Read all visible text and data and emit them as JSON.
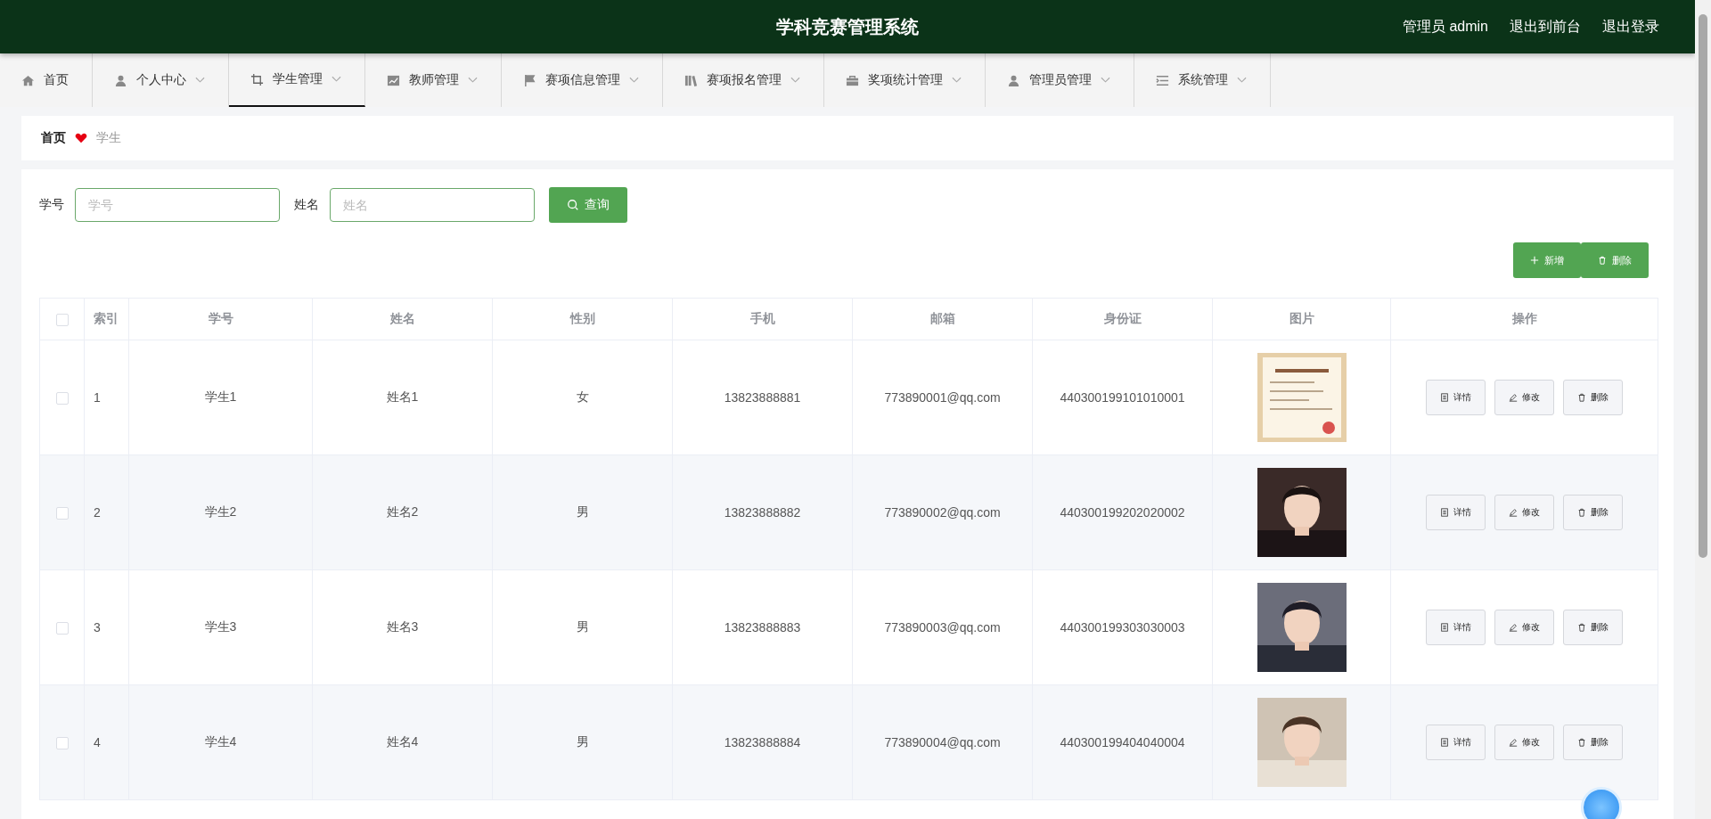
{
  "header": {
    "title": "学科竞赛管理系统",
    "user": "管理员 admin",
    "links": [
      "退出到前台",
      "退出登录"
    ]
  },
  "nav": [
    {
      "label": "首页",
      "dropdown": false,
      "selected": false
    },
    {
      "label": "个人中心",
      "dropdown": true,
      "selected": false
    },
    {
      "label": "学生管理",
      "dropdown": true,
      "selected": true
    },
    {
      "label": "教师管理",
      "dropdown": true,
      "selected": false
    },
    {
      "label": "赛项信息管理",
      "dropdown": true,
      "selected": false
    },
    {
      "label": "赛项报名管理",
      "dropdown": true,
      "selected": false
    },
    {
      "label": "奖项统计管理",
      "dropdown": true,
      "selected": false
    },
    {
      "label": "管理员管理",
      "dropdown": true,
      "selected": false
    },
    {
      "label": "系统管理",
      "dropdown": true,
      "selected": false
    }
  ],
  "breadcrumb": [
    "首页",
    "学生"
  ],
  "search": {
    "fields": [
      {
        "label": "学号",
        "placeholder": "学号"
      },
      {
        "label": "姓名",
        "placeholder": "姓名"
      }
    ],
    "button": "查询"
  },
  "actions": [
    "新增",
    "删除"
  ],
  "table": {
    "select_all_checked": false,
    "columns": [
      "索引",
      "学号",
      "姓名",
      "性别",
      "手机",
      "邮箱",
      "身份证",
      "图片",
      "操作"
    ],
    "rows": [
      {
        "checked": false,
        "index": "1",
        "id": "学生1",
        "name": "姓名1",
        "gender": "女",
        "phone": "13823888881",
        "email": "773890001@qq.com",
        "idcard": "440300199101010001",
        "buttons": [
          "详情",
          "修改",
          "删除"
        ]
      },
      {
        "checked": false,
        "index": "2",
        "id": "学生2",
        "name": "姓名2",
        "gender": "男",
        "phone": "13823888882",
        "email": "773890002@qq.com",
        "idcard": "440300199202020002",
        "buttons": [
          "详情",
          "修改",
          "删除"
        ]
      },
      {
        "checked": false,
        "index": "3",
        "id": "学生3",
        "name": "姓名3",
        "gender": "男",
        "phone": "13823888883",
        "email": "773890003@qq.com",
        "idcard": "440300199303030003",
        "buttons": [
          "详情",
          "修改",
          "删除"
        ]
      },
      {
        "checked": false,
        "index": "4",
        "id": "学生4",
        "name": "姓名4",
        "gender": "男",
        "phone": "13823888884",
        "email": "773890004@qq.com",
        "idcard": "440300199404040004",
        "buttons": [
          "详情",
          "修改",
          "删除"
        ]
      }
    ]
  }
}
